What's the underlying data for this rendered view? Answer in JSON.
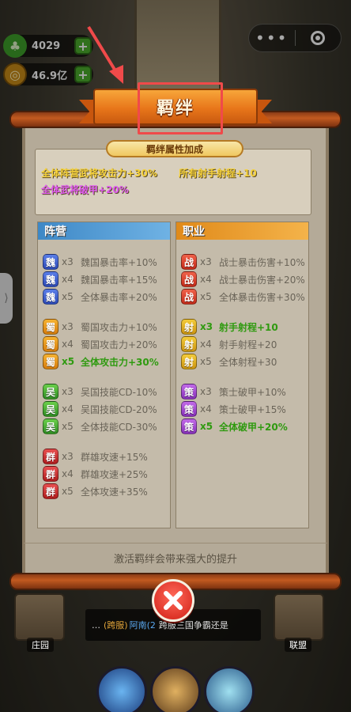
{
  "currency": {
    "food": "4029",
    "gold": "46.9亿"
  },
  "panel": {
    "title": "羁绊",
    "bonus_header": "羁绊属性加成",
    "bonus_lines": [
      {
        "a": "全体阵营武将攻击力+30%",
        "b": "所有射手射程+10",
        "a_color": "#f5d13a",
        "b_color": "#f5d13a"
      },
      {
        "a": "全体武将破甲+20%",
        "b": "",
        "a_color": "#e05cf0"
      }
    ],
    "camp_header": "阵营",
    "job_header": "职业",
    "footer": "激活羁绊会带来强大的提升"
  },
  "camp_rows": [
    {
      "badge": "魏",
      "cls": "b-wei",
      "count": "x3",
      "text": "魏国暴击率+10%",
      "active": false
    },
    {
      "badge": "魏",
      "cls": "b-wei",
      "count": "x4",
      "text": "魏国暴击率+15%",
      "active": false
    },
    {
      "badge": "魏",
      "cls": "b-wei",
      "count": "x5",
      "text": "全体暴击率+20%",
      "active": false
    },
    {
      "badge": "蜀",
      "cls": "b-shu",
      "count": "x3",
      "text": "蜀国攻击力+10%",
      "active": false
    },
    {
      "badge": "蜀",
      "cls": "b-shu",
      "count": "x4",
      "text": "蜀国攻击力+20%",
      "active": false
    },
    {
      "badge": "蜀",
      "cls": "b-shu",
      "count": "x5",
      "text": "全体攻击力+30%",
      "active": true
    },
    {
      "badge": "吴",
      "cls": "b-wu",
      "count": "x3",
      "text": "吴国技能CD-10%",
      "active": false
    },
    {
      "badge": "吴",
      "cls": "b-wu",
      "count": "x4",
      "text": "吴国技能CD-20%",
      "active": false
    },
    {
      "badge": "吴",
      "cls": "b-wu",
      "count": "x5",
      "text": "全体技能CD-30%",
      "active": false
    },
    {
      "badge": "群",
      "cls": "b-qun",
      "count": "x3",
      "text": "群雄攻速+15%",
      "active": false
    },
    {
      "badge": "群",
      "cls": "b-qun",
      "count": "x4",
      "text": "群雄攻速+25%",
      "active": false
    },
    {
      "badge": "群",
      "cls": "b-qun",
      "count": "x5",
      "text": "全体攻速+35%",
      "active": false
    }
  ],
  "job_rows": [
    {
      "badge": "战",
      "cls": "b-zhan",
      "count": "x3",
      "text": "战士暴击伤害+10%",
      "active": false
    },
    {
      "badge": "战",
      "cls": "b-zhan",
      "count": "x4",
      "text": "战士暴击伤害+20%",
      "active": false
    },
    {
      "badge": "战",
      "cls": "b-zhan",
      "count": "x5",
      "text": "全体暴击伤害+30%",
      "active": false
    },
    {
      "badge": "射",
      "cls": "b-she",
      "count": "x3",
      "text": "射手射程+10",
      "active": true
    },
    {
      "badge": "射",
      "cls": "b-she",
      "count": "x4",
      "text": "射手射程+20",
      "active": false
    },
    {
      "badge": "射",
      "cls": "b-she",
      "count": "x5",
      "text": "全体射程+30",
      "active": false
    },
    {
      "badge": "策",
      "cls": "b-ce",
      "count": "x3",
      "text": "策士破甲+10%",
      "active": false
    },
    {
      "badge": "策",
      "cls": "b-ce",
      "count": "x4",
      "text": "策士破甲+15%",
      "active": false
    },
    {
      "badge": "策",
      "cls": "b-ce",
      "count": "x5",
      "text": "全体破甲+20%",
      "active": true
    }
  ],
  "scene": {
    "left_building": "庄园",
    "right_building": "联盟",
    "chat_tag": "(跨服)",
    "chat_name": "阿南(2",
    "chat_msg": "跨服三国争霸还是"
  }
}
